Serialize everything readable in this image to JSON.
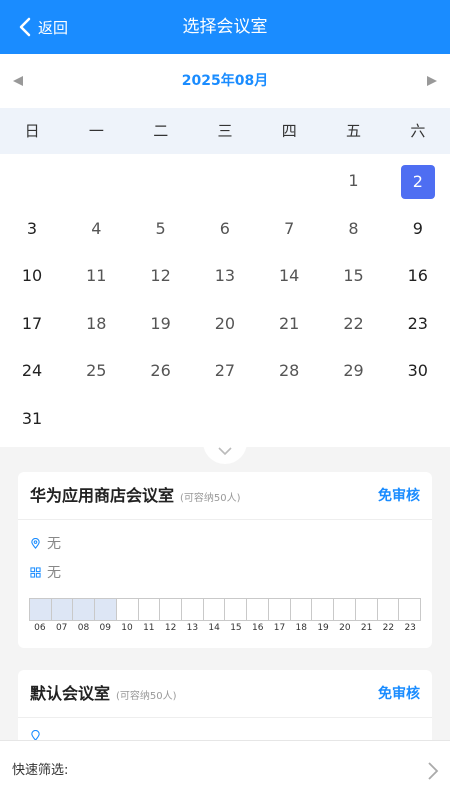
{
  "header": {
    "back_label": "返回",
    "title": "选择会议室",
    "bg_color": "#1a8cff"
  },
  "calendar": {
    "month_label": "2025年08月",
    "prev_icon": "triangle-left-icon",
    "next_icon": "triangle-right-icon",
    "weekdays": [
      "日",
      "一",
      "二",
      "三",
      "四",
      "五",
      "六"
    ],
    "days": [
      "1",
      "2",
      "3",
      "4",
      "5",
      "6",
      "7",
      "8",
      "9",
      "10",
      "11",
      "12",
      "13",
      "14",
      "15",
      "16",
      "17",
      "18",
      "19",
      "20",
      "21",
      "22",
      "23",
      "24",
      "25",
      "26",
      "27",
      "28",
      "29",
      "30",
      "31"
    ],
    "first_weekday_index": 5,
    "selected_day": "2",
    "selected_color": "#4e6ef2"
  },
  "rooms": [
    {
      "name": "华为应用商店会议室",
      "capacity": "(可容纳50人)",
      "tag": "免审核",
      "location": "无",
      "equipment": "无",
      "hours": [
        "06",
        "07",
        "08",
        "09",
        "10",
        "11",
        "12",
        "13",
        "14",
        "15",
        "16",
        "17",
        "18",
        "19",
        "20",
        "21",
        "22",
        "23"
      ],
      "busy_hours": [
        "06",
        "07",
        "08",
        "09"
      ]
    },
    {
      "name": "默认会议室",
      "capacity": "(可容纳50人)",
      "tag": "免审核"
    }
  ],
  "filter": {
    "label": "快速筛选:",
    "icon": "chevron-right-icon"
  }
}
